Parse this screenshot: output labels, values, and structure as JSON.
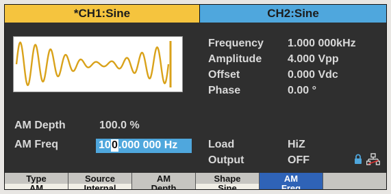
{
  "tabs": {
    "ch1": "*CH1:Sine",
    "ch2": "CH2:Sine"
  },
  "params": {
    "frequency": {
      "label": "Frequency",
      "value": "1.000 000kHz"
    },
    "amplitude": {
      "label": "Amplitude",
      "value": "4.000 Vpp"
    },
    "offset": {
      "label": "Offset",
      "value": "0.000 Vdc"
    },
    "phase": {
      "label": "Phase",
      "value": "0.00 °"
    },
    "load": {
      "label": "Load",
      "value": "HiZ"
    },
    "output": {
      "label": "Output",
      "value": "OFF"
    }
  },
  "am": {
    "depth_label": "AM Depth",
    "depth_value": "100.0 %",
    "freq_label": "AM Freq",
    "freq_prefix": "10",
    "freq_cursor": "0",
    "freq_suffix": ".000 000 Hz"
  },
  "softkeys": [
    {
      "line1": "Type",
      "line2": "AM"
    },
    {
      "line1": "Source",
      "line2": "Internal"
    },
    {
      "line1": "AM",
      "line2": "Depth"
    },
    {
      "line1": "Shape",
      "line2": "Sine"
    },
    {
      "line1": "AM",
      "line2": "Freq"
    },
    {
      "line1": "",
      "line2": ""
    }
  ],
  "icons": {
    "lock": "lock-icon",
    "network": "network-icon"
  },
  "colors": {
    "ch1_tab": "#f5c43e",
    "ch2_tab": "#4fa7dd",
    "waveform": "#d9a21a",
    "active_key": "#2f63b7"
  }
}
